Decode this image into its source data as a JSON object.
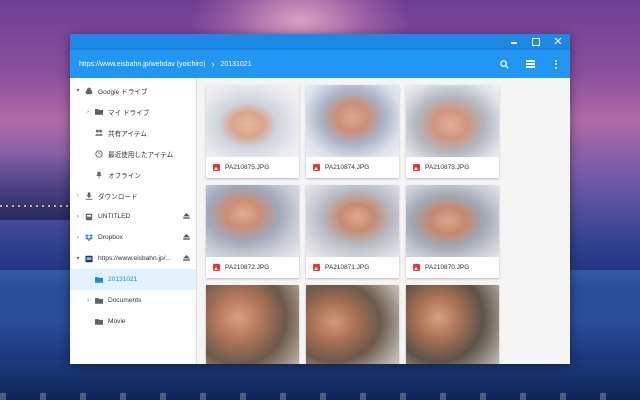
{
  "window": {
    "controls": {
      "minimize": "",
      "maximize": "",
      "close": "✕"
    }
  },
  "toolbar": {
    "breadcrumb": [
      "https://www.eisbahn.jp/webdav (yoichiro)",
      "20131021"
    ],
    "separator": "›",
    "icons": [
      "search-icon",
      "view-list-icon",
      "more-vert-icon"
    ]
  },
  "sidebar": {
    "items": [
      {
        "label": "Google ドライブ",
        "icon": "drive-icon",
        "arrow": "▾",
        "indent": 0
      },
      {
        "label": "マイ ドライブ",
        "icon": "folder-icon",
        "arrow": "›",
        "indent": 1
      },
      {
        "label": "共有アイテム",
        "icon": "people-icon",
        "arrow": "",
        "indent": 1
      },
      {
        "label": "最近使用したアイテム",
        "icon": "clock-icon",
        "arrow": "",
        "indent": 1
      },
      {
        "label": "オフライン",
        "icon": "pin-icon",
        "arrow": "",
        "indent": 1
      },
      {
        "label": "ダウンロード",
        "icon": "download-icon",
        "arrow": "›",
        "indent": 0
      },
      {
        "label": "UNTITLED",
        "icon": "usb-icon",
        "arrow": "›",
        "indent": 0,
        "eject": true
      },
      {
        "label": "Dropbox",
        "icon": "dropbox-icon",
        "arrow": "›",
        "indent": 0,
        "eject": true
      },
      {
        "label": "https://www.eisbahn.jp/...",
        "icon": "network-icon",
        "arrow": "▾",
        "indent": 0,
        "eject": true
      },
      {
        "label": "20131021",
        "icon": "folder-icon",
        "arrow": "",
        "indent": 1,
        "selected": true
      },
      {
        "label": "Documents",
        "icon": "folder-icon",
        "arrow": "›",
        "indent": 1
      },
      {
        "label": "Movie",
        "icon": "folder-icon",
        "arrow": "",
        "indent": 1
      }
    ],
    "eject_icon": "⏏"
  },
  "files": [
    {
      "name": "PA210875.JPG",
      "thumb": "bg-a"
    },
    {
      "name": "PA210874.JPG",
      "thumb": "bg-b"
    },
    {
      "name": "PA210873.JPG",
      "thumb": "bg-c"
    },
    {
      "name": "PA210872.JPG",
      "thumb": "bg-d"
    },
    {
      "name": "PA210871.JPG",
      "thumb": "bg-e"
    },
    {
      "name": "PA210870.JPG",
      "thumb": "bg-f"
    },
    {
      "name": "",
      "thumb": "bg-g"
    },
    {
      "name": "",
      "thumb": "bg-h"
    },
    {
      "name": "",
      "thumb": "bg-i"
    }
  ],
  "colors": {
    "titlebar": "#1e88e5",
    "toolbar": "#2196f3",
    "selected_text": "#1e88e5",
    "file_icon": "#e53935"
  }
}
